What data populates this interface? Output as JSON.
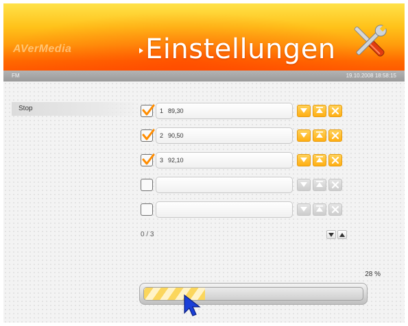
{
  "header": {
    "brand": "AVerMedia",
    "title": "Einstellungen",
    "tools_icon": "tools-icon"
  },
  "status": {
    "mode": "FM",
    "datetime": "19.10.2008 18:58:15"
  },
  "left_menu": {
    "items": [
      {
        "label": "Stop"
      }
    ]
  },
  "stations": [
    {
      "checked": true,
      "number": "1",
      "frequency": "89,30",
      "buttons_active": true
    },
    {
      "checked": true,
      "number": "2",
      "frequency": "90,50",
      "buttons_active": true
    },
    {
      "checked": true,
      "number": "3",
      "frequency": "92,10",
      "buttons_active": true
    },
    {
      "checked": false,
      "number": "",
      "frequency": "",
      "buttons_active": false
    },
    {
      "checked": false,
      "number": "",
      "frequency": "",
      "buttons_active": false
    }
  ],
  "row_button_icons": [
    "move-down-icon",
    "move-up-icon",
    "delete-icon"
  ],
  "pagination": {
    "indicator": "0 / 3"
  },
  "progress": {
    "percent_label": "28 %",
    "value": 0.28
  },
  "colors": {
    "accent_orange": "#ffae12",
    "header_top": "#ffe24a",
    "header_bottom": "#ff5a00",
    "check_orange": "#ff8c00",
    "cursor_blue": "#1a3fd8"
  }
}
